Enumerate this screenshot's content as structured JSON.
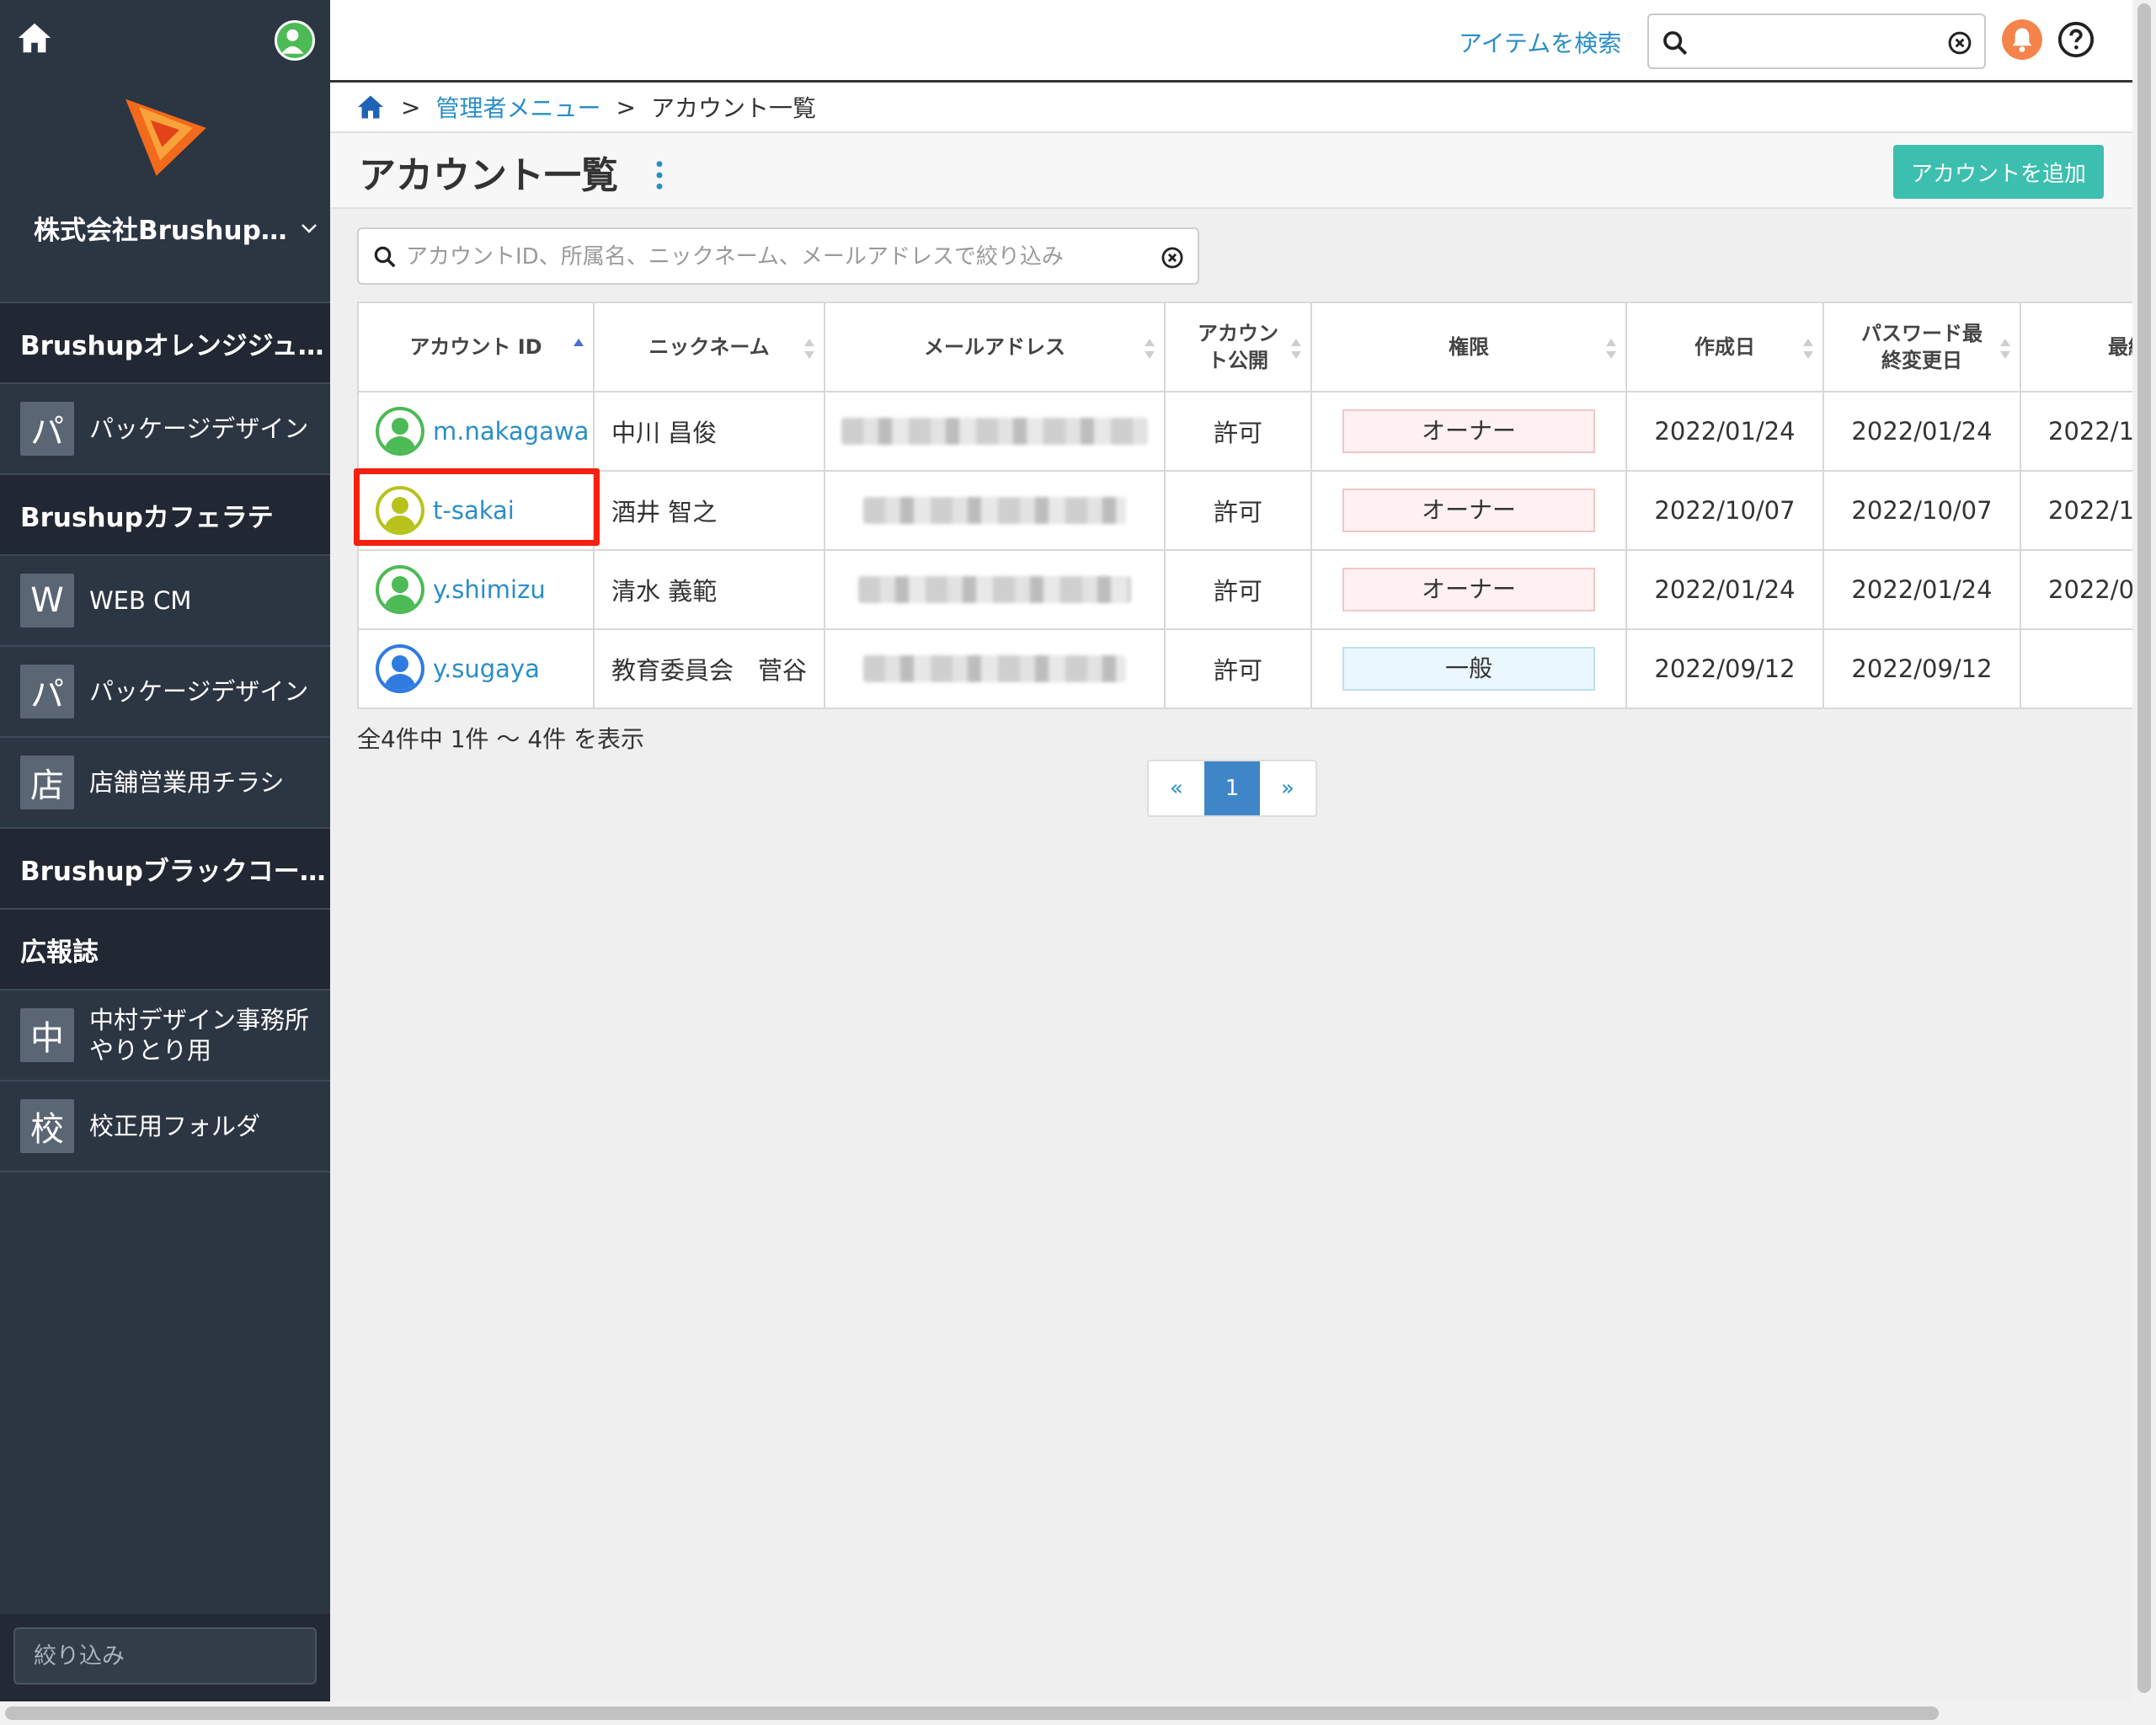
{
  "sidebar": {
    "org_name": "株式会社Brushup…",
    "groups": [
      {
        "title": "Brushupオレンジジュ…",
        "items": [
          {
            "badge": "パ",
            "label": "パッケージデザイン"
          }
        ]
      },
      {
        "title": "Brushupカフェラテ",
        "items": [
          {
            "badge": "W",
            "label": "WEB CM"
          },
          {
            "badge": "パ",
            "label": "パッケージデザイン"
          },
          {
            "badge": "店",
            "label": "店舗営業用チラシ"
          }
        ]
      },
      {
        "title": "Brushupブラックコー…",
        "items": []
      },
      {
        "title": "広報誌",
        "items": [
          {
            "badge": "中",
            "label_line1": "中村デザイン事務所",
            "label_line2": "やりとり用"
          },
          {
            "badge": "校",
            "label": "校正用フォルダ"
          }
        ]
      }
    ],
    "filter_placeholder": "絞り込み"
  },
  "header": {
    "search_label": "アイテムを検索",
    "search_value": ""
  },
  "breadcrumb": {
    "items": [
      "管理者メニュー",
      "アカウント一覧"
    ],
    "separator": ">"
  },
  "page": {
    "title": "アカウント一覧",
    "add_button": "アカウントを追加",
    "filter_placeholder": "アカウントID、所属名、ニックネーム、メールアドレスで絞り込み"
  },
  "table": {
    "columns": [
      "アカウント ID",
      "ニックネーム",
      "メールアドレス",
      "アカウン",
      "ト公開",
      "権限",
      "作成日",
      "パスワード最",
      "終変更日",
      "最終"
    ],
    "rows": [
      {
        "id": "m.nakagawa",
        "nickname": "中川 昌俊",
        "public": "許可",
        "role": "オーナー",
        "created": "2022/01/24",
        "pw_changed": "2022/01/24",
        "last": "2022/1",
        "avatar_color": "#4cba55"
      },
      {
        "id": "t-sakai",
        "nickname": "酒井 智之",
        "public": "許可",
        "role": "オーナー",
        "created": "2022/10/07",
        "pw_changed": "2022/10/07",
        "last": "2022/1",
        "avatar_color": "#b7c31c"
      },
      {
        "id": "y.shimizu",
        "nickname": "清水 義範",
        "public": "許可",
        "role": "オーナー",
        "created": "2022/01/24",
        "pw_changed": "2022/01/24",
        "last": "2022/0",
        "avatar_color": "#4cba55"
      },
      {
        "id": "y.sugaya",
        "nickname": "教育委員会　菅谷",
        "public": "許可",
        "role": "一般",
        "created": "2022/09/12",
        "pw_changed": "2022/09/12",
        "last": "",
        "avatar_color": "#2f7be0"
      }
    ],
    "count_text": "全4件中 1件 〜 4件 を表示"
  },
  "pagination": {
    "prev": "«",
    "current": "1",
    "next": "»"
  },
  "colors": {
    "sidebar_bg": "#2c3542",
    "accent": "#3cbfae",
    "link": "#2a8ec6",
    "highlight": "#f5200f",
    "bell": "#f4844c"
  }
}
